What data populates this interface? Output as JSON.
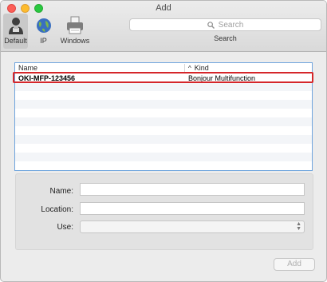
{
  "window": {
    "title": "Add"
  },
  "toolbar": {
    "tools": [
      {
        "label": "Default",
        "icon": "default-printers-icon",
        "active": true
      },
      {
        "label": "IP",
        "icon": "globe-icon",
        "active": false
      },
      {
        "label": "Windows",
        "icon": "windows-printer-icon",
        "active": false
      }
    ],
    "search": {
      "placeholder": "Search",
      "label": "Search"
    }
  },
  "printer_list": {
    "columns": [
      "Name",
      "Kind"
    ],
    "rows": [
      {
        "name": "OKI-MFP-123456",
        "kind": "Bonjour Multifunction",
        "selected": true
      }
    ]
  },
  "form": {
    "name_label": "Name:",
    "location_label": "Location:",
    "use_label": "Use:",
    "name_value": "",
    "location_value": "",
    "use_value": ""
  },
  "actions": {
    "add_label": "Add"
  },
  "colors": {
    "highlight": "#d5262a",
    "list_border": "#6fa4dd"
  }
}
